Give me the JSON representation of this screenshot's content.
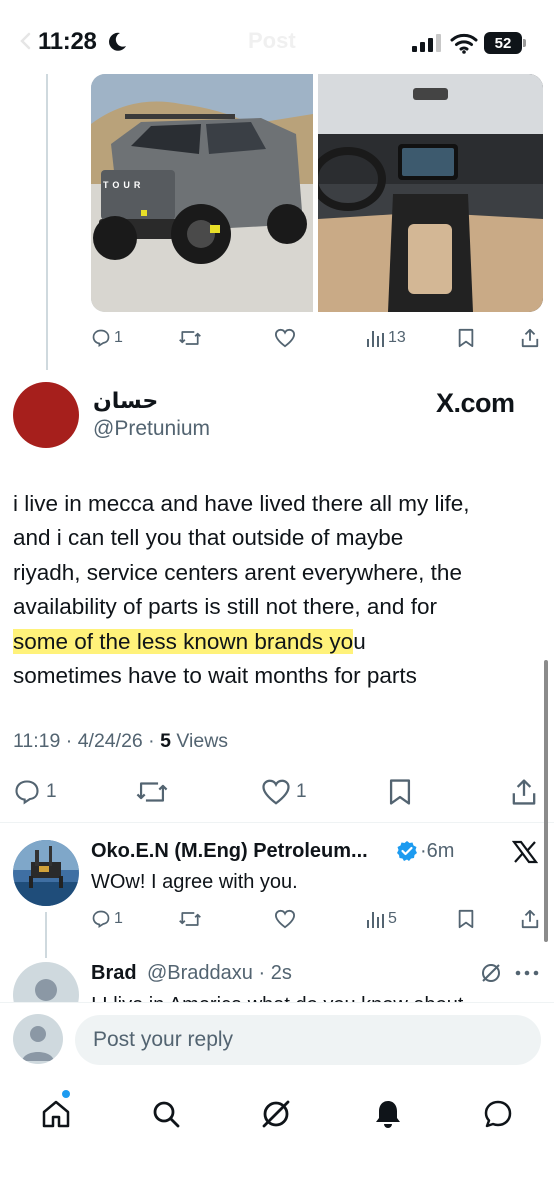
{
  "status_bar": {
    "time": "11:28",
    "faded_title": "Post",
    "battery": "52"
  },
  "media": [
    {
      "label": "TOUR",
      "icon": "suv-exterior-photo"
    },
    {
      "icon": "suv-interior-photo"
    }
  ],
  "top_actions": {
    "replies": "1",
    "views": "13"
  },
  "main_tweet": {
    "author_name": "حسان",
    "author_handle": "@Pretunium",
    "watermark": "X.com",
    "body_lines": [
      "i live in mecca and have lived there all my life,",
      "and i can tell you that outside of maybe",
      "riyadh, service centers arent everywhere, the",
      "availability of parts is still not there, and for",
      "sometimes have to wait months for parts"
    ],
    "highlighted_text": "some of the less known brands yo",
    "after_highlight": "u",
    "time": "11:19",
    "date": "4/24/26",
    "views_count": "5",
    "views_label": " Views",
    "replies": "1",
    "likes": "1"
  },
  "replies": [
    {
      "name": "Oko.E.N (M.Eng) Petroleum...",
      "time": "6m",
      "text": "WOw! I agree with you.",
      "reply_count": "1",
      "views": "5",
      "verified": true
    },
    {
      "name": "Brad",
      "handle": "@Braddaxu",
      "time": "2s",
      "text": "I I live in America what do you know about"
    }
  ],
  "composer": {
    "placeholder": "Post your reply"
  },
  "colors": {
    "accent": "#1d9bf0",
    "secondary_text": "#536471",
    "highlight": "#fff27a",
    "avatar_red": "#a61f1c"
  }
}
